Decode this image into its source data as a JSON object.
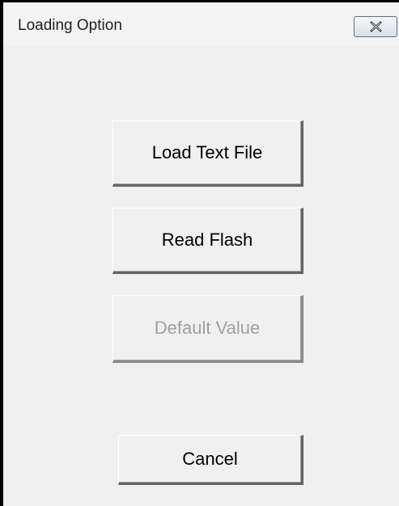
{
  "window": {
    "title": "Loading Option",
    "close_icon": "close-icon"
  },
  "buttons": {
    "load_text_file": "Load Text File",
    "read_flash": "Read Flash",
    "default_value": "Default Value",
    "cancel": "Cancel"
  },
  "colors": {
    "dialog_background": "#f0f0f0",
    "disabled_text": "#a0a0a0",
    "button_shadow": "#646464"
  }
}
